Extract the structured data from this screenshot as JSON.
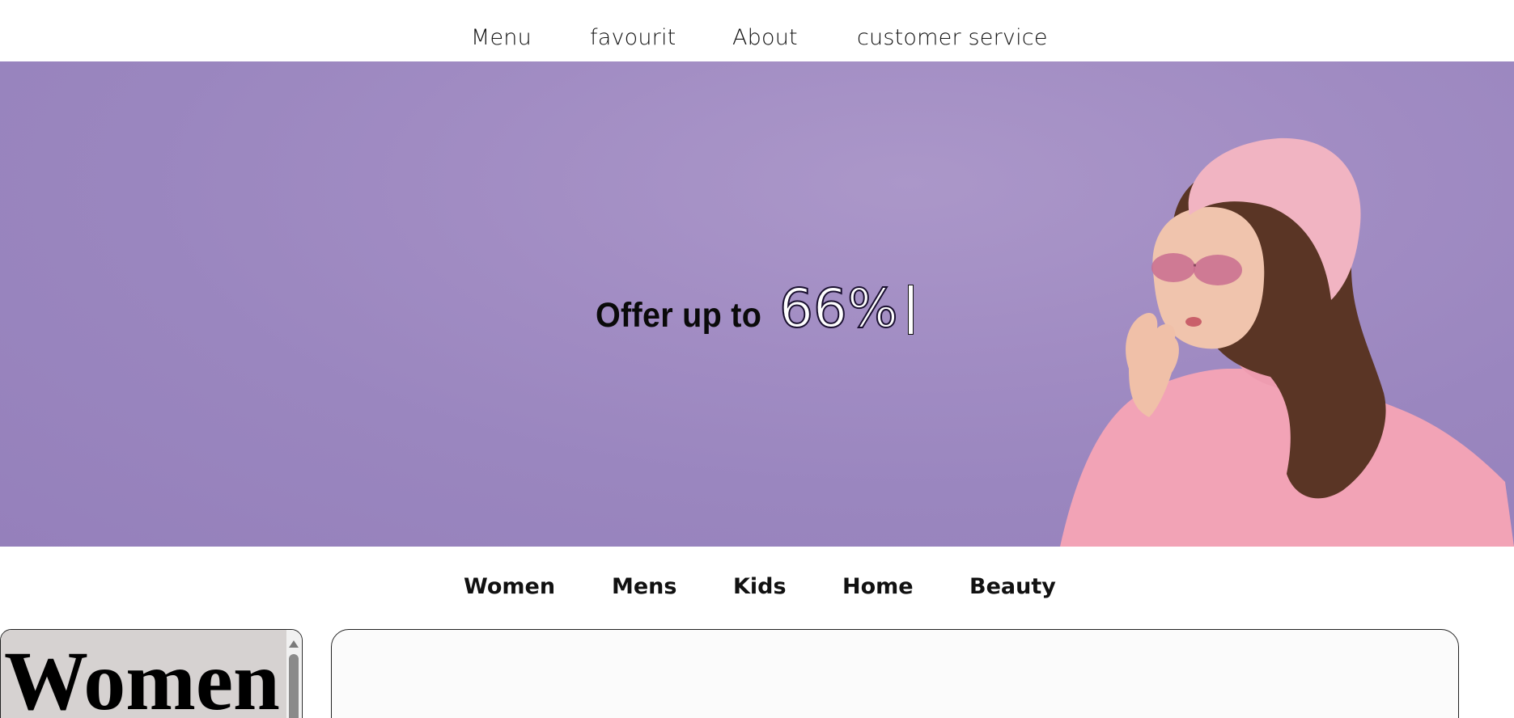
{
  "top_nav": {
    "items": [
      {
        "label": "Menu"
      },
      {
        "label": "favourit"
      },
      {
        "label": "About"
      },
      {
        "label": "customer service"
      }
    ]
  },
  "hero": {
    "prefix": "Offer up to",
    "value": "66%",
    "background_color": "#9d89c2"
  },
  "category_nav": {
    "items": [
      {
        "label": "Women"
      },
      {
        "label": "Mens"
      },
      {
        "label": "Kids"
      },
      {
        "label": "Home"
      },
      {
        "label": "Beauty"
      }
    ]
  },
  "side_panel": {
    "heading": "Women"
  },
  "icons": {
    "scroll_up": "scroll-up-icon"
  }
}
